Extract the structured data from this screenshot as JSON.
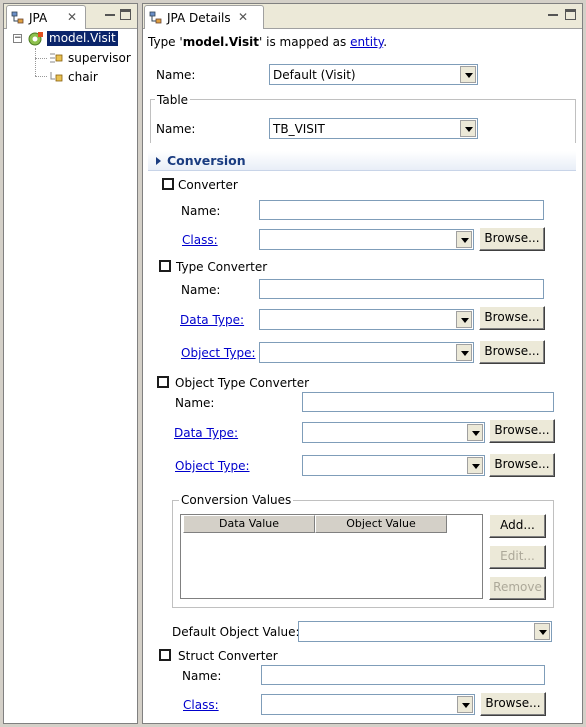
{
  "left_view": {
    "tab_label": "JPA",
    "tree": {
      "root_label": "model.Visit",
      "children": [
        "supervisor",
        "chair"
      ]
    }
  },
  "main_view": {
    "tab_label": "JPA Details",
    "header": {
      "prefix": "Type '",
      "entity_name": "model.Visit",
      "middle": "' is mapped as ",
      "link": "entity",
      "suffix": "."
    },
    "name_label": "Name:",
    "name_value": "Default (Visit)",
    "table_group": {
      "title": "Table",
      "name_label": "Name:",
      "name_value": "TB_VISIT"
    },
    "conversion": {
      "title": "Conversion",
      "converter": {
        "label": "Converter",
        "name_label": "Name:",
        "class_label": "Class:",
        "browse": "Browse..."
      },
      "type_converter": {
        "label": "Type Converter",
        "name_label": "Name:",
        "data_type_label": "Data Type:",
        "object_type_label": "Object Type:",
        "browse": "Browse..."
      },
      "object_type_converter": {
        "label": "Object Type Converter",
        "name_label": "Name:",
        "data_type_label": "Data Type:",
        "object_type_label": "Object Type:",
        "browse": "Browse...",
        "values_group": {
          "title": "Conversion Values",
          "columns": [
            "Data Value",
            "Object Value"
          ],
          "add": "Add...",
          "edit": "Edit...",
          "remove": "Remove"
        },
        "default_object_value_label": "Default Object Value:"
      },
      "struct_converter": {
        "label": "Struct Converter",
        "name_label": "Name:",
        "class_label": "Class:",
        "browse": "Browse..."
      }
    }
  },
  "colors": {
    "selection": "#0a246a",
    "link": "#0000cc",
    "section_title": "#1a3c80"
  }
}
